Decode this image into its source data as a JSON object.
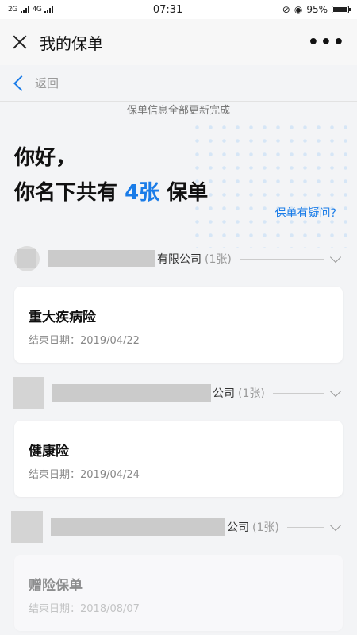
{
  "status_bar": {
    "network_left": "2G",
    "network_right": "4G",
    "time": "07:31",
    "battery": "95%",
    "battery_level": 0.95
  },
  "title_bar": {
    "title": "我的保单",
    "more": "•••"
  },
  "back": {
    "label": "返回"
  },
  "update_message": "保单信息全部更新完成",
  "greeting": {
    "line1": "你好，",
    "line2_prefix": "你名下共有",
    "count": "4张",
    "line2_suffix": "保单",
    "question_link": "保单有疑问?"
  },
  "groups": [
    {
      "company_suffix": "有限公司",
      "count": "(1张)",
      "policies": [
        {
          "name": "重大疾病险",
          "end_date": "结束日期：2019/04/22"
        }
      ]
    },
    {
      "company_suffix": "公司",
      "count": "(1张)",
      "policies": [
        {
          "name": "健康险",
          "end_date": "结束日期：2019/04/24"
        }
      ]
    },
    {
      "company_suffix": "公司",
      "count": "(1张)",
      "policies": [
        {
          "name": "赠险保单",
          "end_date": "结束日期：2018/08/07"
        }
      ]
    }
  ]
}
